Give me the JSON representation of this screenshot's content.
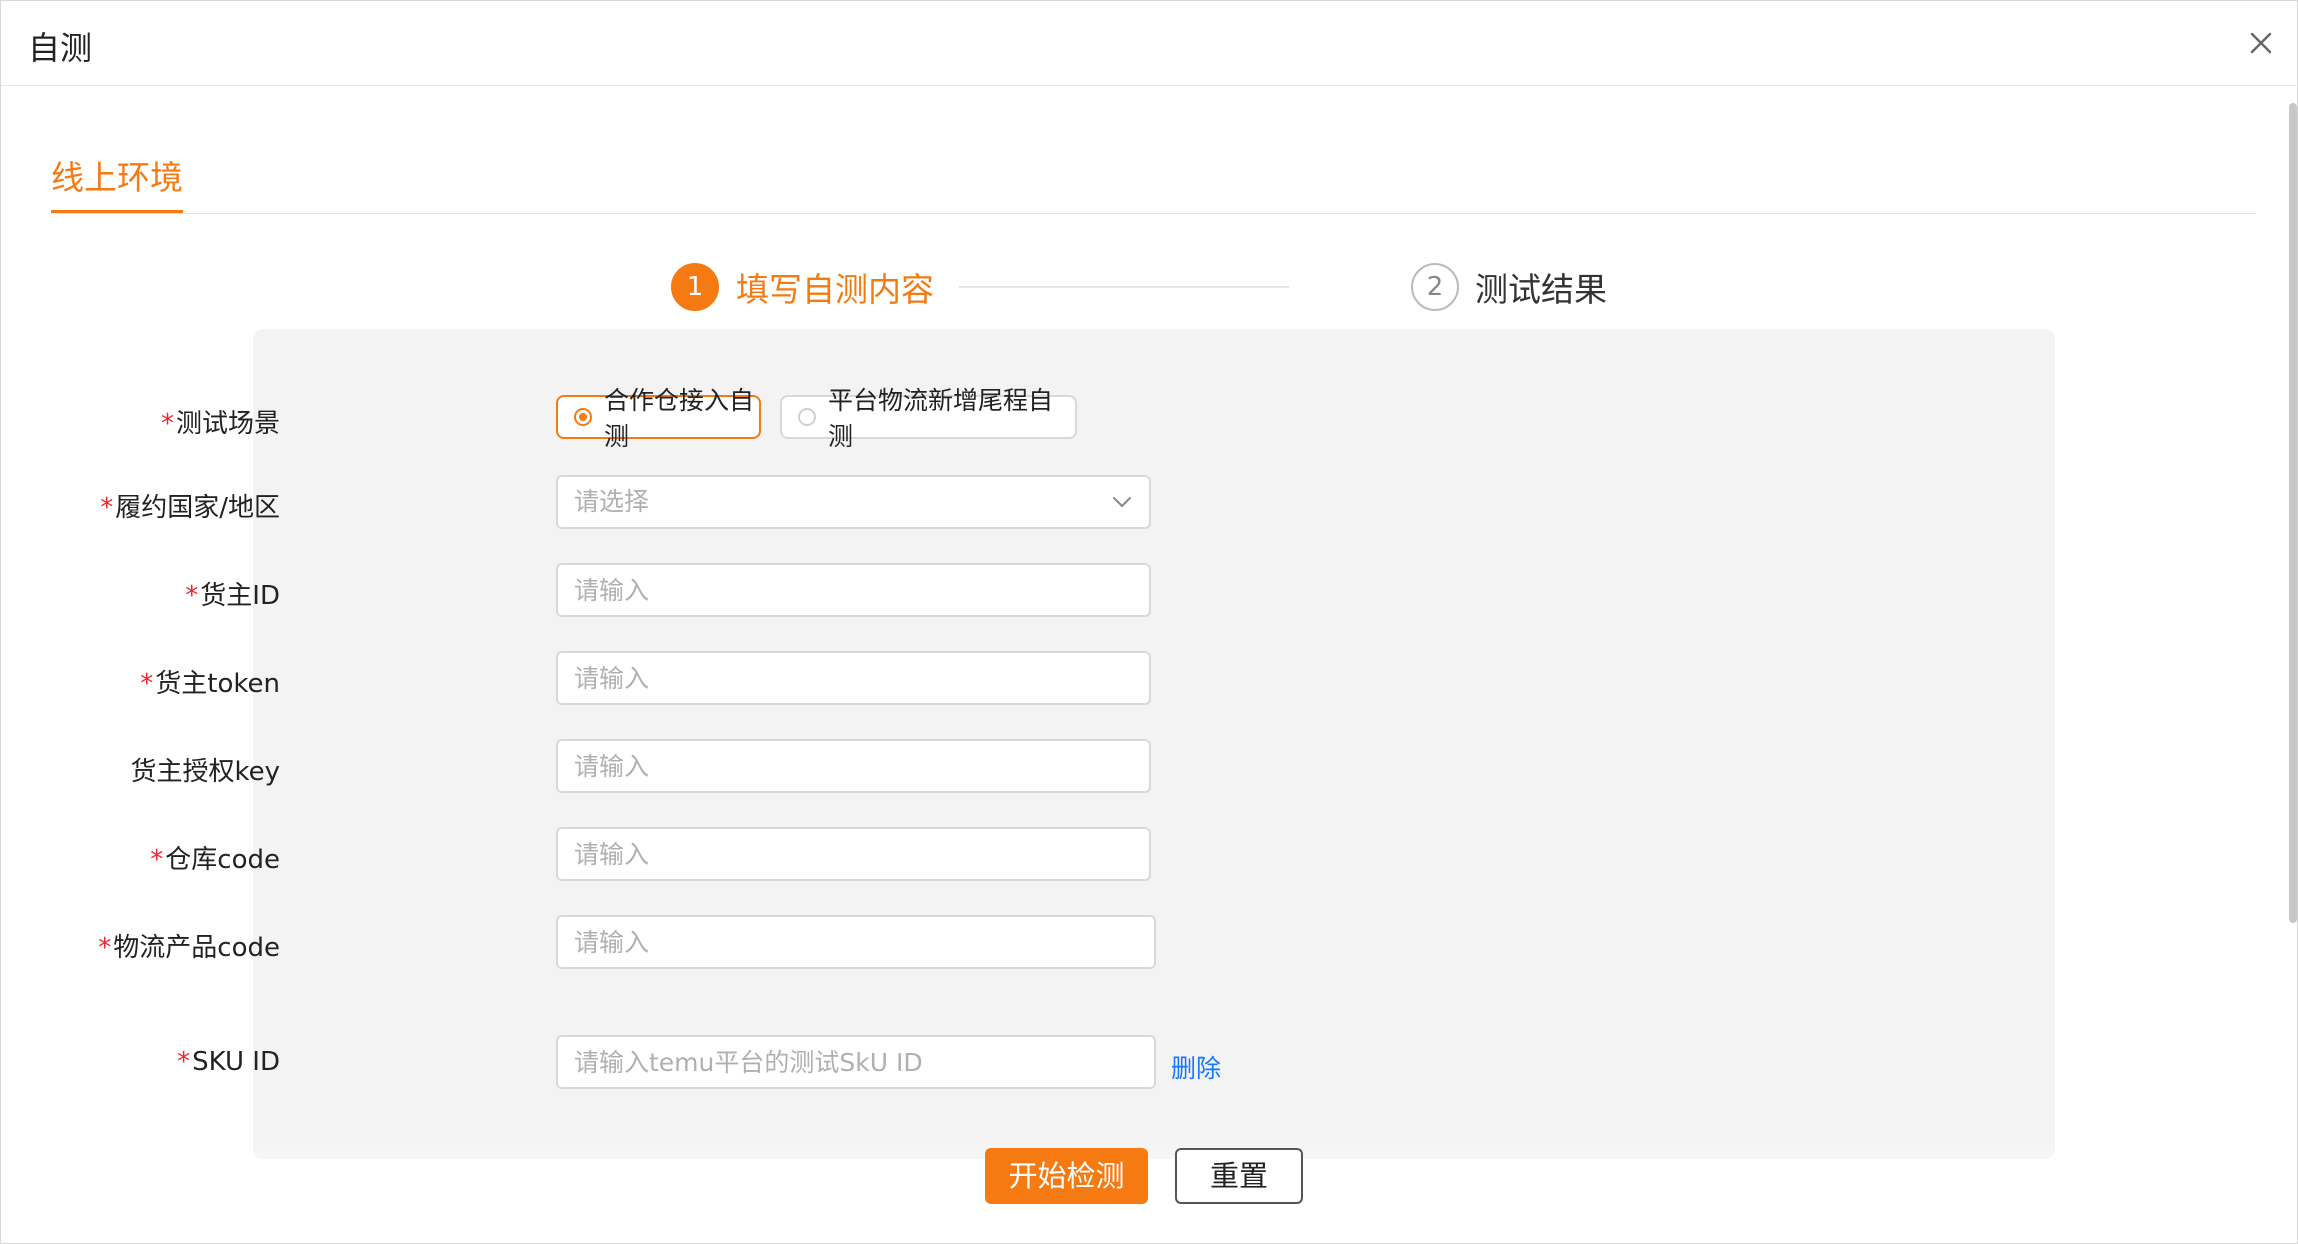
{
  "dialog": {
    "title": "自测"
  },
  "tabs": [
    {
      "label": "线上环境"
    }
  ],
  "steps": [
    {
      "number": "1",
      "label": "填写自测内容"
    },
    {
      "number": "2",
      "label": "测试结果"
    }
  ],
  "form": {
    "scenario": {
      "label": "测试场景",
      "options": [
        "合作仓接入自测",
        "平台物流新增尾程自测"
      ]
    },
    "country": {
      "label": "履约国家/地区",
      "placeholder": "请选择"
    },
    "owner_id": {
      "label": "货主ID",
      "placeholder": "请输入"
    },
    "owner_token": {
      "label": "货主token",
      "placeholder": "请输入"
    },
    "owner_auth_key": {
      "label": "货主授权key",
      "placeholder": "请输入"
    },
    "warehouse_code": {
      "label": "仓库code",
      "placeholder": "请输入"
    },
    "logistics_code": {
      "label": "物流产品code",
      "placeholder": "请输入"
    },
    "sku_id": {
      "label": "SKU ID",
      "placeholder": "请输入temu平台的测试SkU ID",
      "delete": "删除"
    }
  },
  "actions": {
    "start": "开始检测",
    "reset": "重置"
  },
  "colors": {
    "accent": "#f57a12",
    "link": "#1677ff",
    "required": "#f5222d"
  }
}
